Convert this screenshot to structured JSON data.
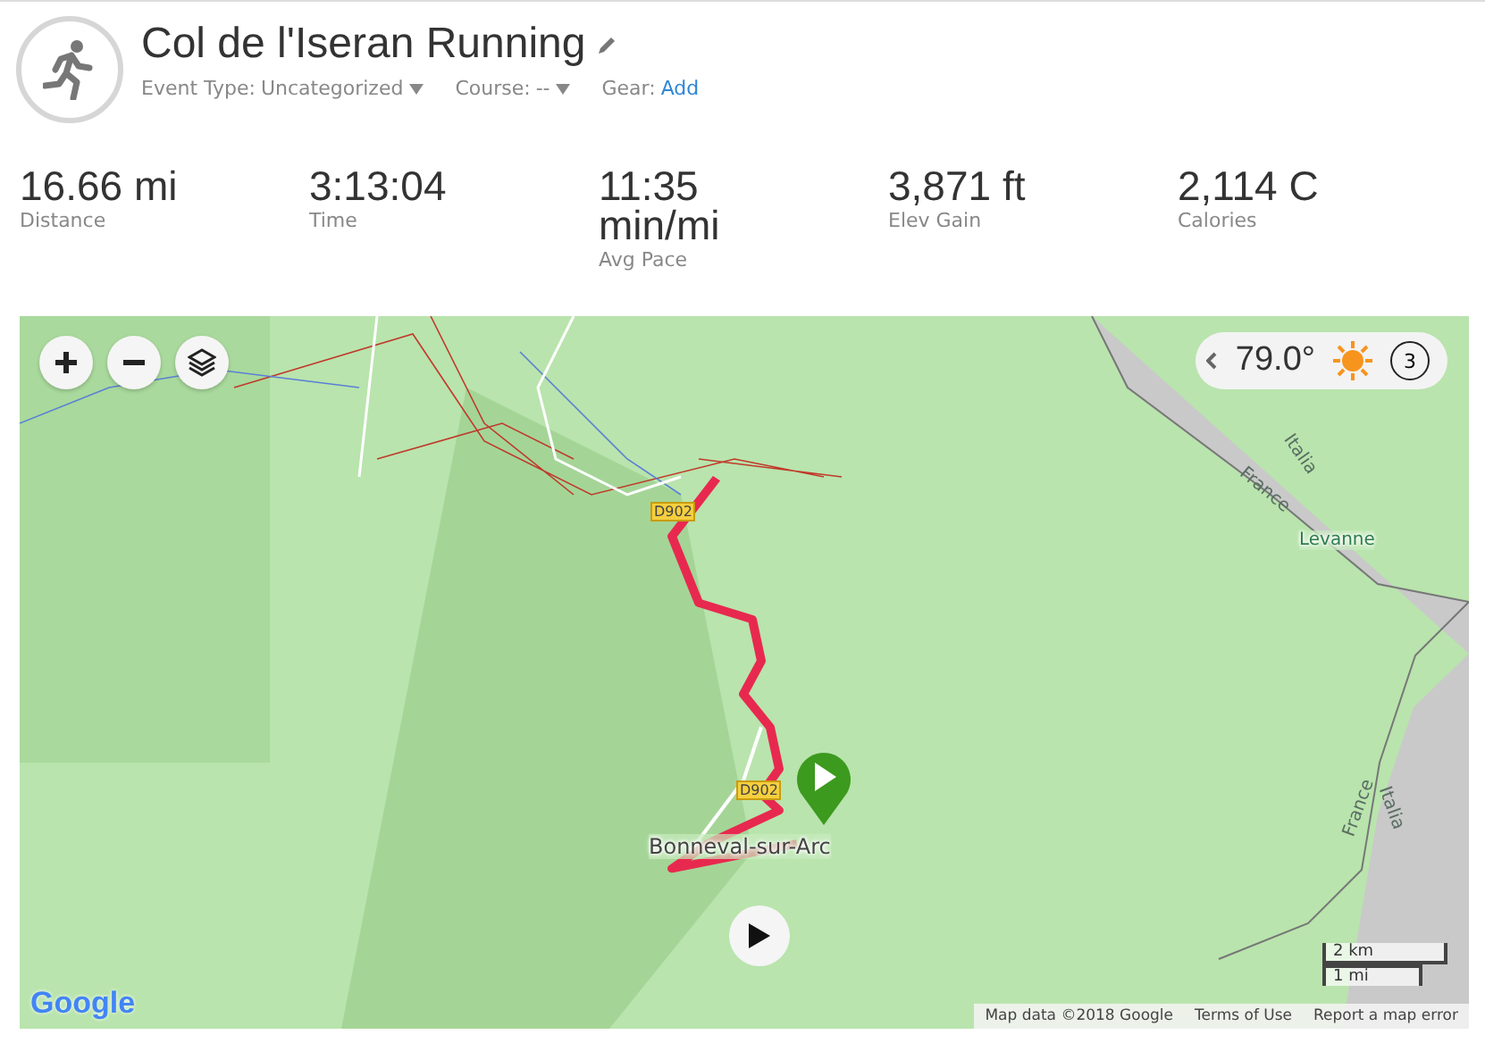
{
  "activity": {
    "title": "Col de l'Iseran Running",
    "meta": [
      {
        "label": "Event Type:",
        "value": "Uncategorized",
        "kind": "dropdown"
      },
      {
        "label": "Course:",
        "value": "--",
        "kind": "dropdown"
      },
      {
        "label": "Gear:",
        "value": "Add",
        "kind": "link"
      }
    ]
  },
  "stats": [
    {
      "value": "16.66 mi",
      "label": "Distance"
    },
    {
      "value": "3:13:04",
      "label": "Time"
    },
    {
      "value": "11:35 min/mi",
      "label": "Avg Pace"
    },
    {
      "value": "3,871 ft",
      "label": "Elev Gain"
    },
    {
      "value": "2,114 C",
      "label": "Calories"
    }
  ],
  "map": {
    "weather": {
      "temperature": "79.0°",
      "lap": "3"
    },
    "labels": [
      {
        "text": "D902",
        "kind": "road"
      },
      {
        "text": "D902",
        "kind": "road"
      },
      {
        "text": "Bonneval-sur-Arc",
        "kind": "place"
      },
      {
        "text": "Italia",
        "kind": "border"
      },
      {
        "text": "France",
        "kind": "border"
      },
      {
        "text": "Levanne",
        "kind": "peak"
      },
      {
        "text": "France",
        "kind": "border"
      },
      {
        "text": "Italia",
        "kind": "border"
      }
    ],
    "logo": "Google",
    "scale": [
      "2 km",
      "1 mi"
    ],
    "footer": [
      "Map data ©2018 Google",
      "Terms of Use",
      "Report a map error"
    ]
  }
}
